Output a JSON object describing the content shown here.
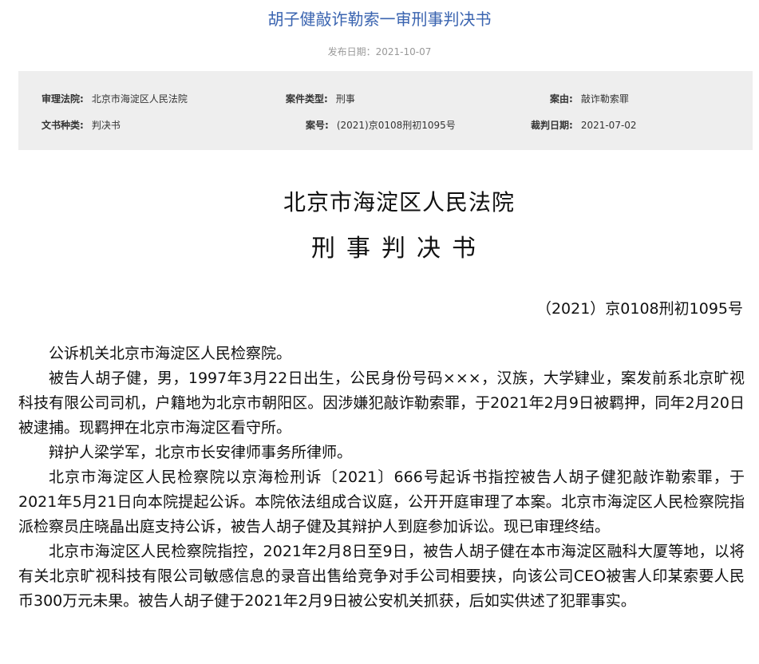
{
  "header": {
    "title": "胡子健敲诈勒索一审刑事判决书",
    "publish_label": "发布日期：",
    "publish_date": "2021-10-07"
  },
  "meta": {
    "court_label": "审理法院:",
    "court_value": "北京市海淀区人民法院",
    "case_type_label": "案件类型:",
    "case_type_value": "刑事",
    "cause_label": "案由:",
    "cause_value": "敲诈勒索罪",
    "doc_kind_label": "文书种类:",
    "doc_kind_value": "判决书",
    "case_no_label": "案号:",
    "case_no_value": "(2021)京0108刑初1095号",
    "judgment_date_label": "裁判日期:",
    "judgment_date_value": "2021-07-02"
  },
  "document": {
    "court_name": "北京市海淀区人民法院",
    "doc_type": "刑事判决书",
    "case_number": "（2021）京0108刑初1095号",
    "paragraphs": [
      "公诉机关北京市海淀区人民检察院。",
      "被告人胡子健，男，1997年3月22日出生，公民身份号码×××，汉族，大学肄业，案发前系北京旷视科技有限公司司机，户籍地为北京市朝阳区。因涉嫌犯敲诈勒索罪，于2021年2月9日被羁押，同年2月20日被逮捕。现羁押在北京市海淀区看守所。",
      "辩护人梁学军，北京市长安律师事务所律师。",
      "北京市海淀区人民检察院以京海检刑诉〔2021〕666号起诉书指控被告人胡子健犯敲诈勒索罪，于2021年5月21日向本院提起公诉。本院依法组成合议庭，公开开庭审理了本案。北京市海淀区人民检察院指派检察员庄晓晶出庭支持公诉，被告人胡子健及其辩护人到庭参加诉讼。现已审理终结。",
      "北京市海淀区人民检察院指控，2021年2月8日至9日，被告人胡子健在本市海淀区融科大厦等地，以将有关北京旷视科技有限公司敏感信息的录音出售给竞争对手公司相要挟，向该公司CEO被害人印某索要人民币300万元未果。被告人胡子健于2021年2月9日被公安机关抓获，后如实供述了犯罪事实。"
    ]
  }
}
